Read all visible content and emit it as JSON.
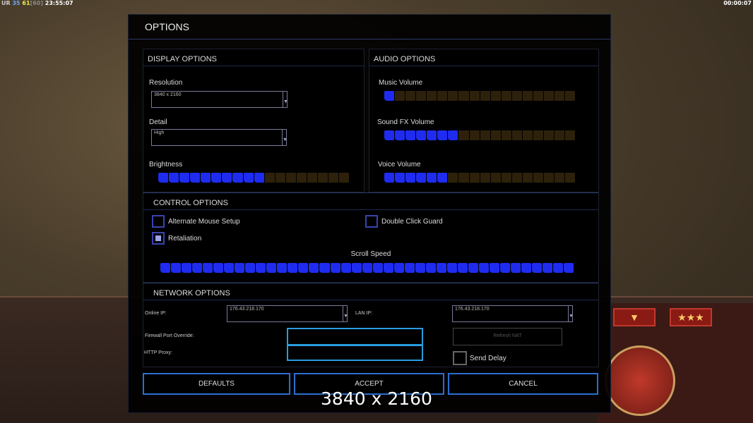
{
  "hud": {
    "stats_ur": "UR",
    "stats_a": "35",
    "stats_b": "61",
    "stats_c": "[60]",
    "clock": "23:55:07",
    "timer": "00:00:07"
  },
  "options": {
    "title": "OPTIONS",
    "display": {
      "header": "DISPLAY OPTIONS",
      "resolution_label": "Resolution",
      "resolution_value": "3840 x 2160",
      "detail_label": "Detail",
      "detail_value": "High",
      "brightness_label": "Brightness",
      "brightness": {
        "value": 10,
        "max": 18
      }
    },
    "audio": {
      "header": "AUDIO OPTIONS",
      "music_label": "Music Volume",
      "music": {
        "value": 1,
        "max": 18
      },
      "sfx_label": "Sound FX Volume",
      "sfx": {
        "value": 7,
        "max": 18
      },
      "voice_label": "Voice Volume",
      "voice": {
        "value": 6,
        "max": 18
      }
    },
    "control": {
      "header": "CONTROL OPTIONS",
      "alt_mouse_label": "Alternate Mouse Setup",
      "alt_mouse": false,
      "double_click_label": "Double Click Guard",
      "double_click": false,
      "retaliation_label": "Retaliation",
      "retaliation": true,
      "scroll_label": "Scroll Speed",
      "scroll": {
        "value": 39,
        "max": 39
      }
    },
    "network": {
      "header": "NETWORK OPTIONS",
      "online_ip_label": "Online IP:",
      "online_ip": "176.43.218.170",
      "lan_ip_label": "LAN IP:",
      "lan_ip": "176.43.218.170",
      "firewall_label": "Firewall Port Override:",
      "firewall_value": "",
      "proxy_label": "HTTP Proxy:",
      "proxy_value": "",
      "refresh_nat": "Refresh NAT",
      "send_delay_label": "Send Delay",
      "send_delay": false
    },
    "buttons": {
      "defaults": "DEFAULTS",
      "accept": "ACCEPT",
      "cancel": "CANCEL"
    }
  },
  "caption": "3840 x 2160",
  "colors": {
    "slider_on": "#1f2cf0",
    "slider_off": "#2e210b",
    "accent": "#2b6fd0"
  }
}
